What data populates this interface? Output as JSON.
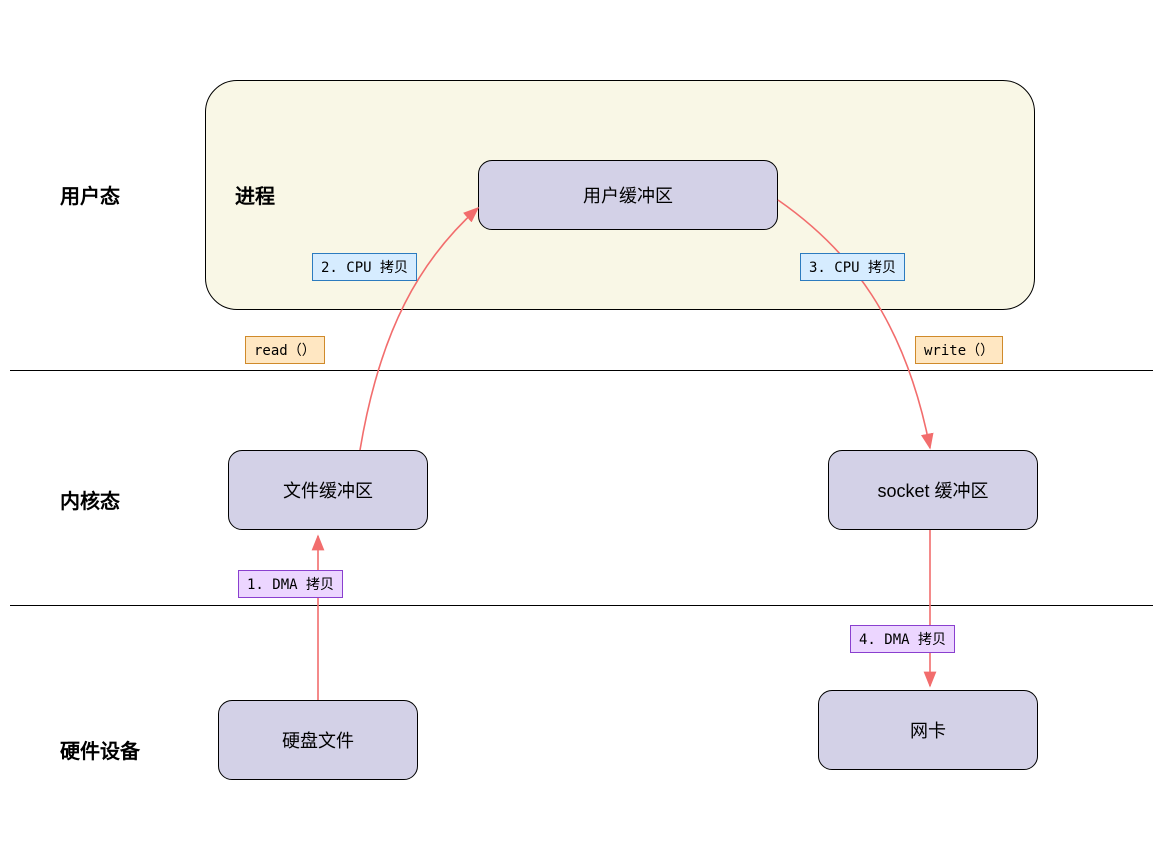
{
  "layers": {
    "user": "用户态",
    "kernel": "内核态",
    "hw": "硬件设备"
  },
  "process": {
    "title": "进程"
  },
  "nodes": {
    "user_buffer": "用户缓冲区",
    "file_buffer": "文件缓冲区",
    "socket_buffer": "socket 缓冲区",
    "disk_file": "硬盘文件",
    "nic": "网卡"
  },
  "labels": {
    "read": "read（）",
    "write": "write（）",
    "step1": "1. DMA 拷贝",
    "step2": "2. CPU 拷贝",
    "step3": "3. CPU 拷贝",
    "step4": "4. DMA 拷贝"
  },
  "colors": {
    "node_fill": "#d3d1e7",
    "process_fill": "#f9f7e6",
    "arrow": "#f26d6d",
    "tag_orange": "#ffe7c2",
    "tag_blue": "#d6ecff",
    "tag_purple": "#ecd6ff"
  }
}
